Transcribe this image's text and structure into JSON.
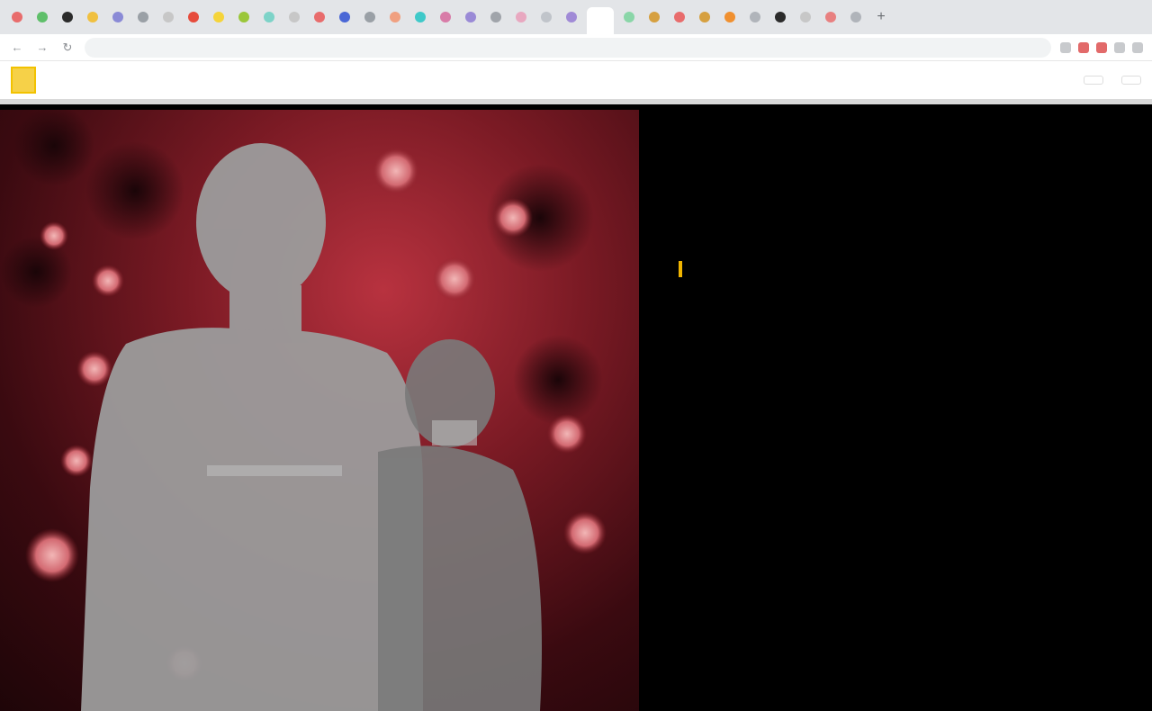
{
  "browser": {
    "tabs": [
      {
        "color": "#e86c6c"
      },
      {
        "color": "#5fbf6a"
      },
      {
        "color": "#2b2b2b"
      },
      {
        "color": "#f0c040"
      },
      {
        "color": "#8a8ad6"
      },
      {
        "color": "#9aa0a6"
      },
      {
        "color": "#c7c7c7"
      },
      {
        "color": "#e64b3c"
      },
      {
        "color": "#f5d43a"
      },
      {
        "color": "#9bc73a"
      },
      {
        "color": "#7dd3c8"
      },
      {
        "color": "#c7c7c7"
      },
      {
        "color": "#e86c6c"
      },
      {
        "color": "#4a67d6"
      },
      {
        "color": "#9aa0a6"
      },
      {
        "color": "#f0a080"
      },
      {
        "color": "#3fc9c9"
      },
      {
        "color": "#d87ca8"
      },
      {
        "color": "#9a8ad6"
      },
      {
        "color": "#a0a4aa"
      },
      {
        "color": "#e8a8c0"
      },
      {
        "color": "#c0c4ca"
      },
      {
        "color": "#a08ad6"
      }
    ],
    "tabs_right": [
      {
        "color": "#8ad6a8"
      },
      {
        "color": "#d6a040"
      },
      {
        "color": "#e86c6c"
      },
      {
        "color": "#d6a040"
      },
      {
        "color": "#f09030"
      },
      {
        "color": "#b0b4ba"
      },
      {
        "color": "#2b2b2b"
      },
      {
        "color": "#c7c7c7"
      },
      {
        "color": "#e88080"
      },
      {
        "color": "#b0b4ba"
      }
    ],
    "new_tab": "+",
    "url": "",
    "back": "←",
    "forward": "→",
    "reload": "↻"
  },
  "site": {
    "logo_text": "",
    "subscribe_label": "",
    "menu_label": ""
  },
  "hero": {
    "kicker_section": "",
    "kicker_topic": "",
    "headline": "",
    "dek": ""
  }
}
